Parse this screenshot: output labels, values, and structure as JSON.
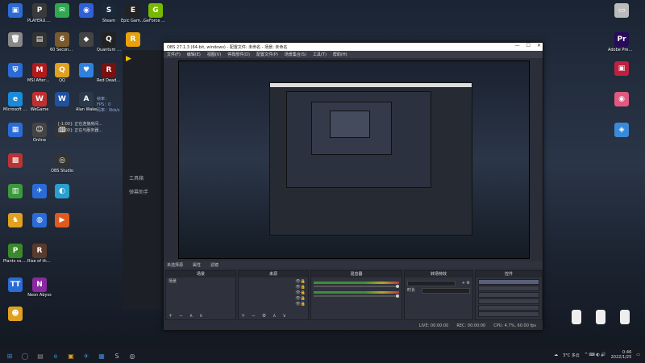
{
  "desktop_left": [
    {
      "label": "",
      "color": "#2a6bd6",
      "glyph": "▣"
    },
    {
      "label": "PLAYERU... BATTLEGR...",
      "color": "#3a3a3a",
      "glyph": "P"
    },
    {
      "label": "",
      "color": "#2fa84f",
      "glyph": "✉"
    },
    {
      "label": "",
      "color": "#3060d8",
      "glyph": "◉"
    },
    {
      "label": "Steam",
      "color": "#1b2838",
      "glyph": "S"
    },
    {
      "label": "Epic Games Launcher",
      "color": "#222",
      "glyph": "E"
    },
    {
      "label": "GeForce Experience",
      "color": "#76b900",
      "glyph": "G"
    },
    {
      "label": "",
      "color": "#888",
      "glyph": "🗑"
    },
    {
      "label": "",
      "color": "#333",
      "glyph": "▤"
    },
    {
      "label": "60 Seconds! Reatomized",
      "color": "#7a5a2a",
      "glyph": "6"
    },
    {
      "label": "",
      "color": "#444",
      "glyph": "◆"
    },
    {
      "label": "Quantum Break",
      "color": "#222",
      "glyph": "Q"
    },
    {
      "label": "",
      "color": "#e8a10c",
      "glyph": "R"
    },
    {
      "label": "",
      "color": "#2a6bd6",
      "glyph": "⛨"
    },
    {
      "label": "MSI Afterburner",
      "color": "#b31b1b",
      "glyph": "M"
    },
    {
      "label": "QQ",
      "color": "#e0a020",
      "glyph": "Q"
    },
    {
      "label": "",
      "color": "#3080e0",
      "glyph": "♥"
    },
    {
      "label": "Red Dead Redemption",
      "color": "#7a1010",
      "glyph": "R"
    },
    {
      "label": "Microsoft Edge",
      "color": "#1b8ad8",
      "glyph": "e"
    },
    {
      "label": "WeGame",
      "color": "#c03030",
      "glyph": "W"
    },
    {
      "label": "",
      "color": "#2050a0",
      "glyph": "W"
    },
    {
      "label": "Alan Wake",
      "color": "#2a3a4a",
      "glyph": "A"
    },
    {
      "label": "",
      "color": "#2a6bd6",
      "glyph": "▦"
    },
    {
      "label": "Online",
      "color": "#444",
      "glyph": "☺"
    },
    {
      "label": "",
      "color": "#333",
      "glyph": "▧"
    },
    {
      "label": "",
      "color": "#b33",
      "glyph": "▩"
    },
    {
      "label": "OBS Studio",
      "color": "#333",
      "glyph": "◎"
    },
    {
      "label": "",
      "color": "#3a9a3a",
      "glyph": "▥"
    },
    {
      "label": "",
      "color": "#2a6bd6",
      "glyph": "✈"
    },
    {
      "label": "",
      "color": "#2aa0d0",
      "glyph": "◐"
    },
    {
      "label": "",
      "color": "#e0a020",
      "glyph": "♞"
    },
    {
      "label": "",
      "color": "#2a6bd6",
      "glyph": "◍"
    },
    {
      "label": "",
      "color": "#e05a20",
      "glyph": "▶"
    },
    {
      "label": "Plants vs. Zombies",
      "color": "#3a8a2a",
      "glyph": "P"
    },
    {
      "label": "Rise of the Tomb Rai...",
      "color": "#5a3a2a",
      "glyph": "R"
    },
    {
      "label": "",
      "color": "#2a6bd6",
      "glyph": "TT"
    },
    {
      "label": "Neon Abyss",
      "color": "#8a2aa0",
      "glyph": "N"
    },
    {
      "label": "",
      "color": "#e0a020",
      "glyph": "☻"
    }
  ],
  "desktop_right": [
    {
      "label": "",
      "color": "#bbb",
      "glyph": "▭"
    },
    {
      "label": "Adobe Premiere...",
      "color": "#2a0a5a",
      "glyph": "Pr"
    },
    {
      "label": "",
      "color": "#c02040",
      "glyph": "▣"
    },
    {
      "label": "",
      "color": "#e05a80",
      "glyph": "◉"
    },
    {
      "label": "",
      "color": "#3a8ad8",
      "glyph": "◈"
    }
  ],
  "desktop_files": [
    {
      "label": "",
      "color": "#eee"
    },
    {
      "label": "",
      "color": "#eee"
    },
    {
      "label": "",
      "color": "#eee"
    }
  ],
  "stream_app": {
    "nav": [
      "",
      "工具箱",
      "弹幕助手",
      "",
      "",
      ""
    ],
    "bottom": "",
    "logs": [
      "[-1:00]: 正在连接房间...",
      "[-1:00]: 正在与服务器..."
    ],
    "stats": [
      "帧率：",
      "FPS：0",
      "码率：0kb/s"
    ]
  },
  "obs": {
    "title": "OBS 27.1.3 (64-bit, windows) - 配置文件: 未命名 - 场景: 未命名",
    "menu": [
      "文件(F)",
      "编辑(E)",
      "视图(V)",
      "停靠部件(D)",
      "配置文件(P)",
      "场景集合(S)",
      "工具(T)",
      "帮助(H)"
    ],
    "scene_tabs": [
      "未选择源",
      "属性",
      "滤镜"
    ],
    "docks": {
      "scenes": {
        "header": "场景",
        "items": [
          "场景"
        ]
      },
      "sources": {
        "header": "来源",
        "items": [
          "",
          "",
          "",
          "",
          ""
        ]
      },
      "mixer": {
        "header": "混音器",
        "tracks": [
          {
            "name": "",
            "db": ""
          },
          {
            "name": "",
            "db": ""
          }
        ]
      },
      "transitions": {
        "header": "转场特效",
        "type": "",
        "duration_label": "时长",
        "duration": ""
      },
      "controls": {
        "header": "控件",
        "buttons": [
          "",
          "",
          "",
          "",
          "",
          ""
        ]
      }
    },
    "status": [
      "LIVE: 00:00:00",
      "REC: 00:00:00",
      "CPU: 4.7%, 60.00 fps"
    ]
  },
  "taskbar": {
    "icons": [
      {
        "glyph": "⊞",
        "color": "#3a8ad8"
      },
      {
        "glyph": "◯",
        "color": "#888"
      },
      {
        "glyph": "▤",
        "color": "#888"
      },
      {
        "glyph": "e",
        "color": "#1b8ad8"
      },
      {
        "glyph": "▣",
        "color": "#e0a020"
      },
      {
        "glyph": "✈",
        "color": "#3a8ad8"
      },
      {
        "glyph": "▦",
        "color": "#3a8ad8"
      },
      {
        "glyph": "S",
        "color": "#bbb"
      },
      {
        "glyph": "◎",
        "color": "#ccc"
      }
    ],
    "weather": "3°C 多云",
    "time": "0:46",
    "date": "2022/1/25"
  }
}
